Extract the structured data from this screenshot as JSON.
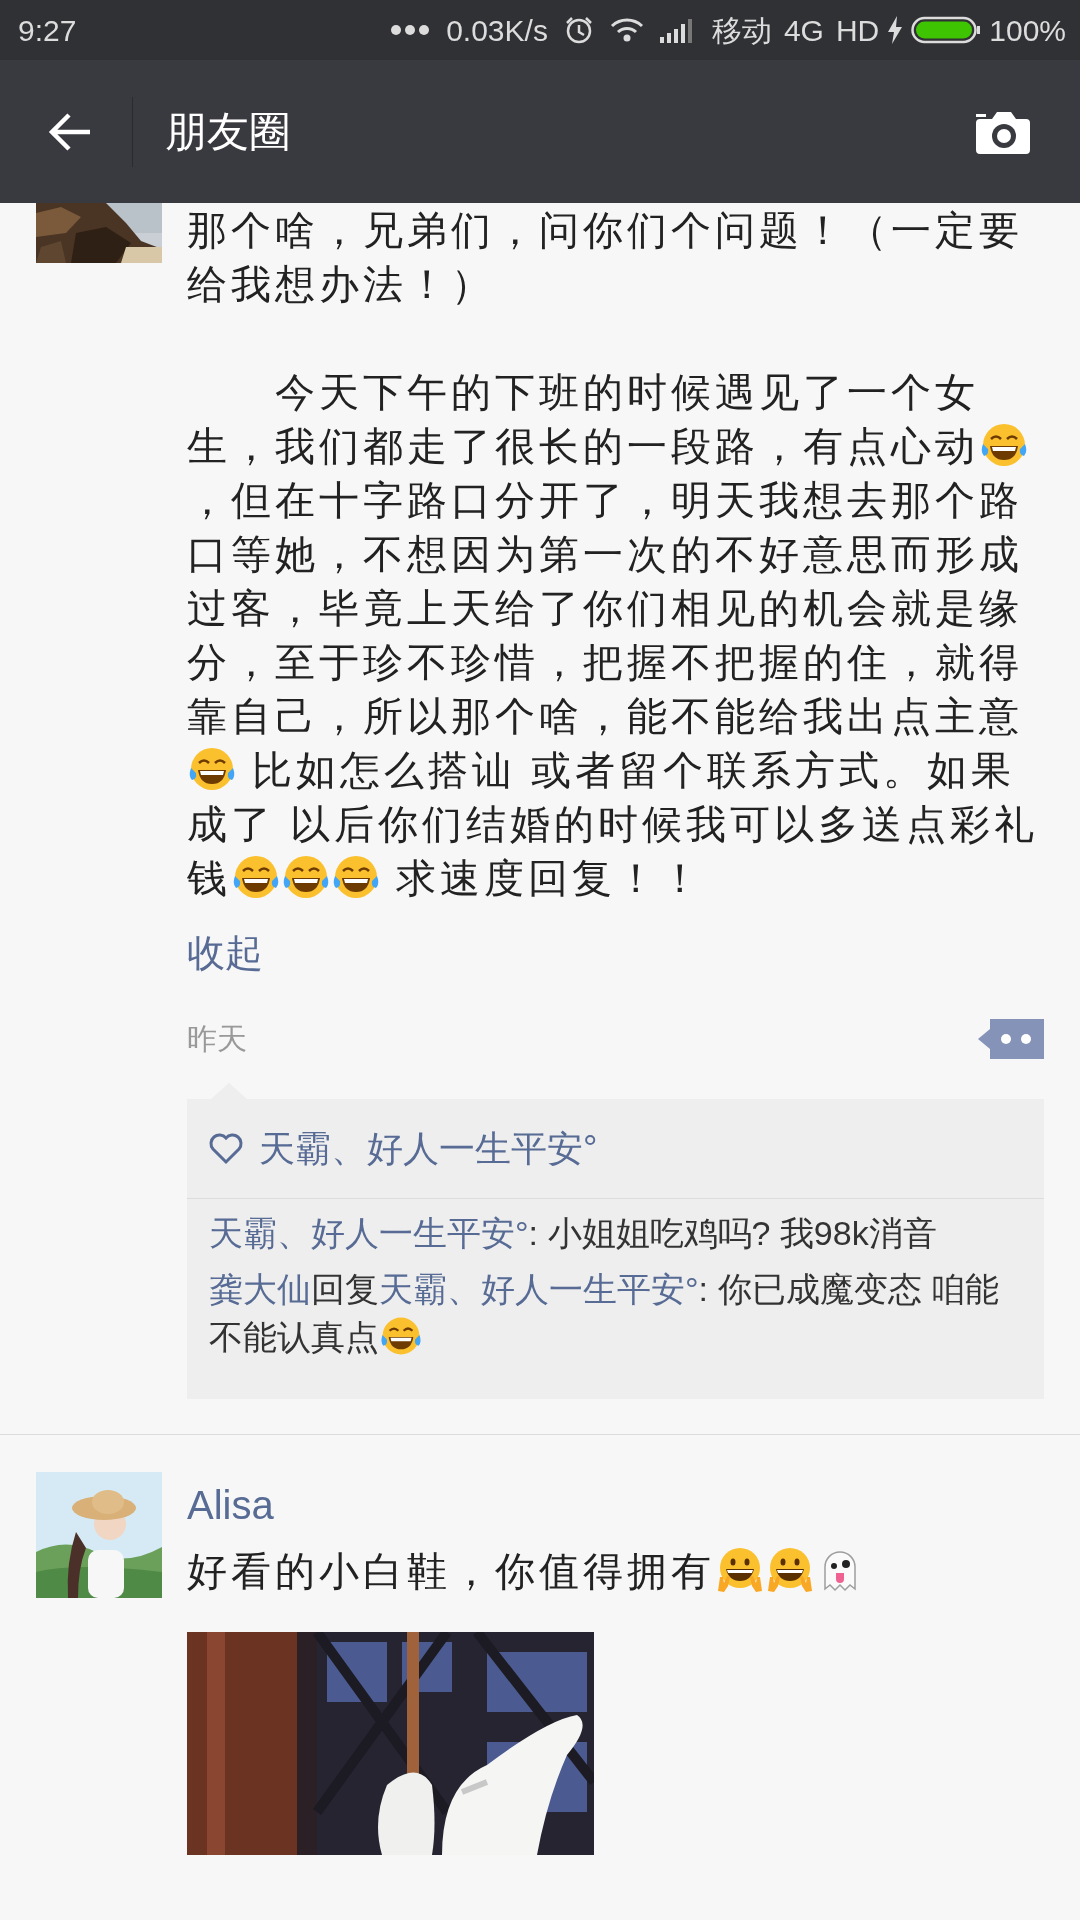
{
  "status_bar": {
    "time": "9:27",
    "network_speed": "0.03K/s",
    "carrier": "移动",
    "network": "4G",
    "hd": "HD",
    "battery_text": "100%"
  },
  "header": {
    "title": "朋友圈"
  },
  "posts": [
    {
      "avatar": {
        "kind": "picture"
      },
      "paragraphs": [
        [
          {
            "kind": "text",
            "text": "那个啥，兄弟们，问你们个问题！（一定要给我想办法！）"
          }
        ],
        [
          {
            "kind": "text",
            "text": "　　今天下午的下班的时候遇见了一个女生，我们都走了很长的一段路，有点心动"
          },
          {
            "kind": "tears"
          },
          {
            "kind": "text",
            "text": " ，但在十字路口分开了，明天我想去那个路口等她，不想因为第一次的不好意思而形成过客，毕竟上天给了你们相见的机会就是缘分，至于珍不珍惜，把握不把握的住，就得靠自己，所以那个啥，能不能给我出点主意"
          },
          {
            "kind": "tears"
          },
          {
            "kind": "text",
            "text": " 比如怎么搭讪 或者留个联系方式。如果成了 以后你们结婚的时候我可以多送点彩礼钱"
          },
          {
            "kind": "tears"
          },
          {
            "kind": "tears"
          },
          {
            "kind": "tears"
          },
          {
            "kind": "text",
            "text": " 求速度回复！！"
          }
        ]
      ],
      "collapse_link": "收起",
      "time": "昨天",
      "likes": "天霸、好人一生平安°",
      "comments": [
        [
          {
            "kind": "link",
            "text": "天霸、好人一生平安°"
          },
          {
            "kind": "text",
            "text": ": 小姐姐吃鸡吗? 我98k消音"
          }
        ],
        [
          {
            "kind": "link",
            "text": "龚大仙"
          },
          {
            "kind": "text",
            "text": "回复"
          },
          {
            "kind": "link",
            "text": "天霸、好人一生平安°"
          },
          {
            "kind": "text",
            "text": ": 你已成魔变态 咱能不能认真点"
          },
          {
            "kind": "tears"
          }
        ]
      ]
    },
    {
      "avatar": {
        "kind": "picture"
      },
      "author": "Alisa",
      "paragraphs": [
        [
          {
            "kind": "text",
            "text": "好看的小白鞋，你值得拥有"
          },
          {
            "kind": "grin"
          },
          {
            "kind": "grin"
          },
          {
            "kind": "ghost"
          }
        ]
      ],
      "image": {
        "kind": "picture"
      }
    }
  ]
}
